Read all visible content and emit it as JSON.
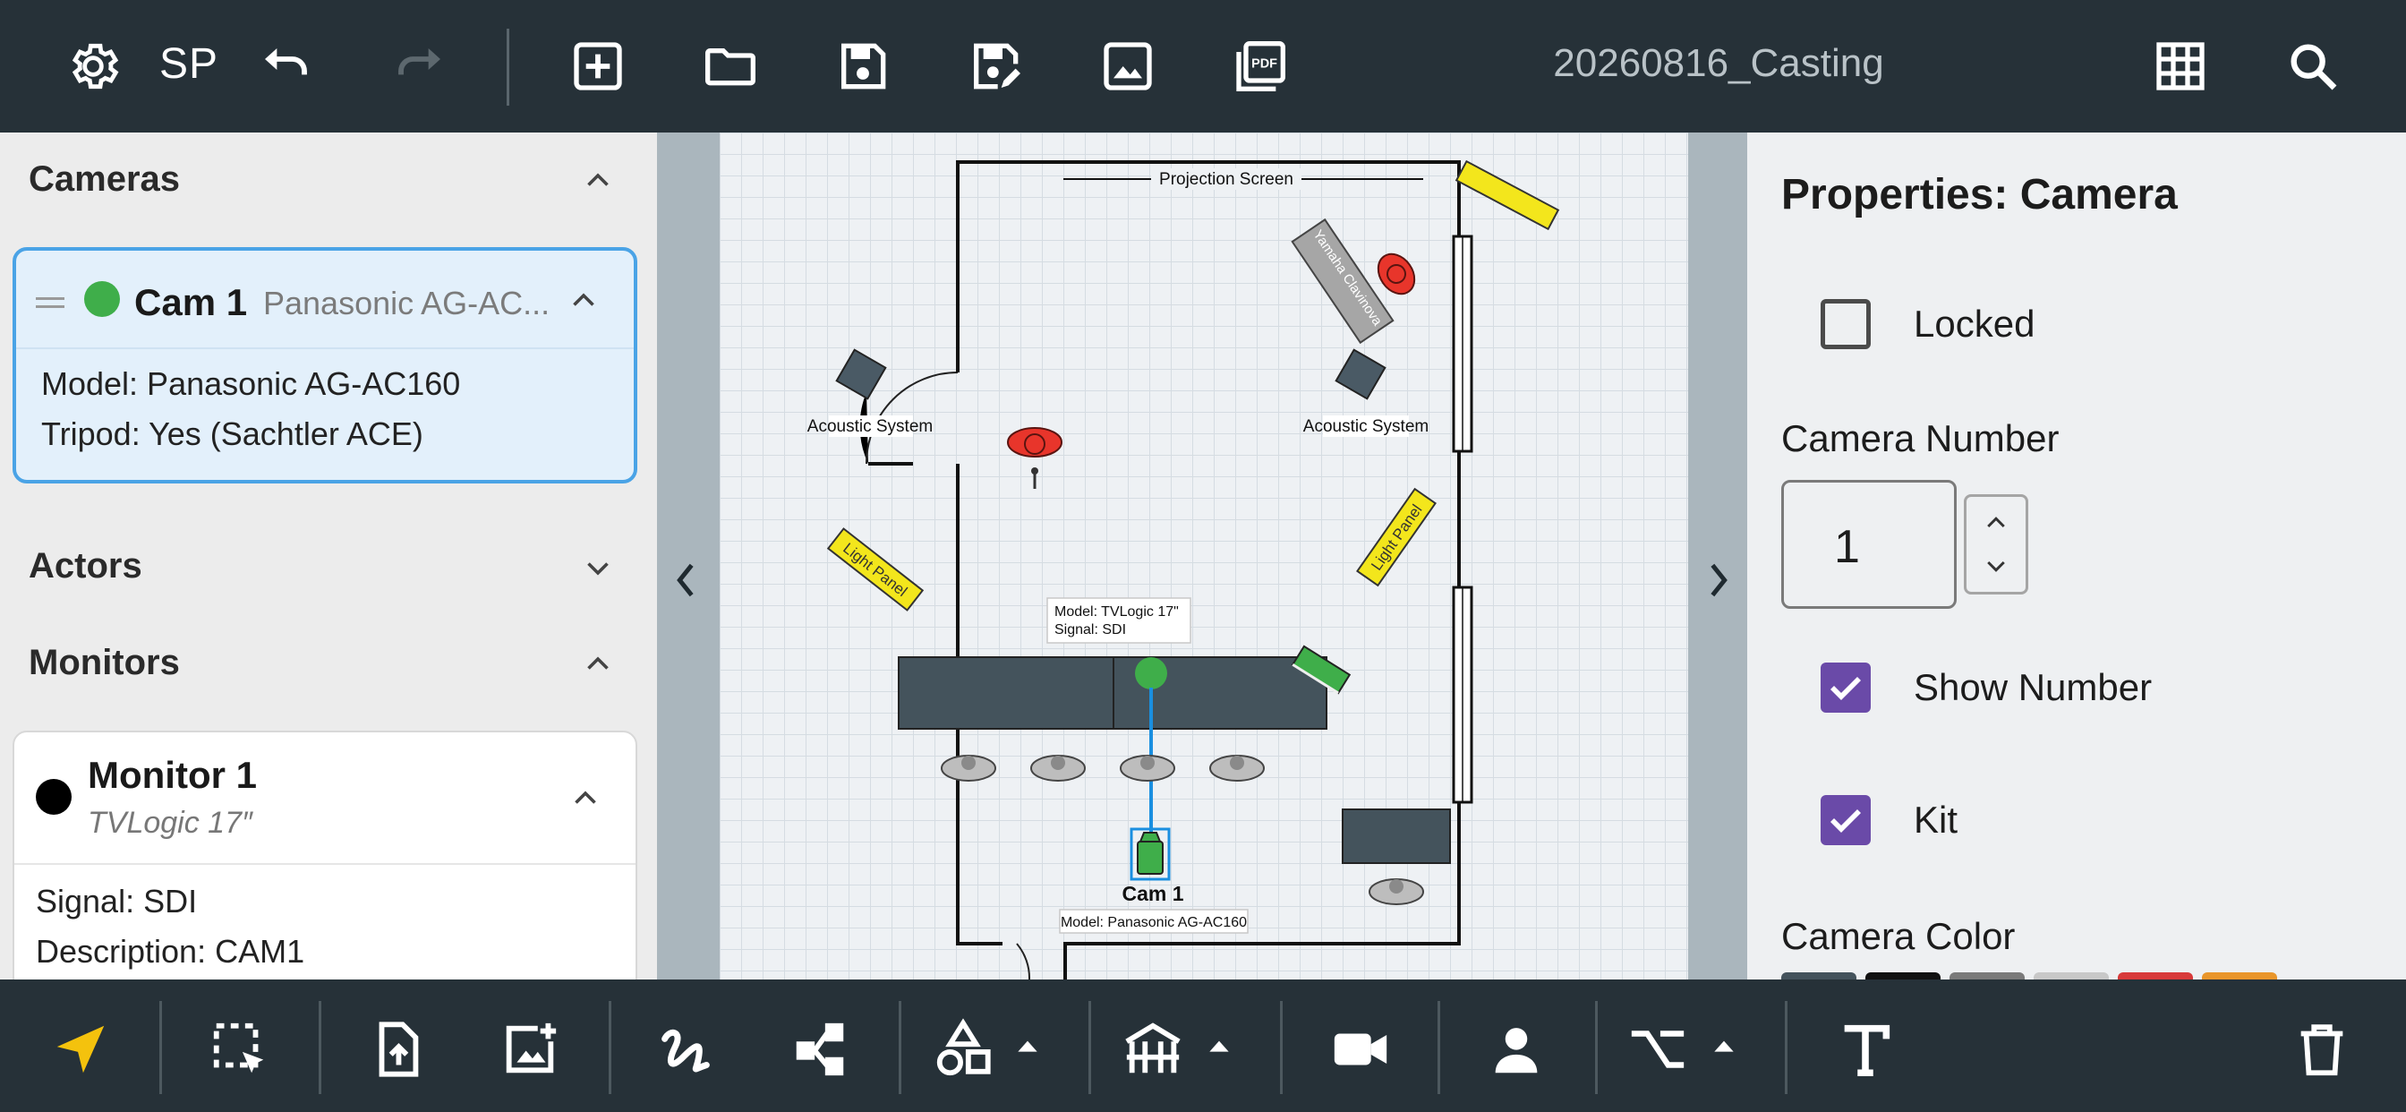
{
  "toolbar": {
    "user_initials": "SP",
    "document_title": "20260816_Casting",
    "icons": [
      "gear-icon",
      "undo-icon",
      "redo-icon",
      "add-icon",
      "folder-icon",
      "save-icon",
      "save-as-icon",
      "image-export-icon",
      "pdf-export-icon",
      "grid-icon",
      "search-icon"
    ],
    "pdf_badge": "PDF"
  },
  "sidebar": {
    "cameras": {
      "title": "Cameras",
      "items": [
        {
          "name": "Cam 1",
          "model_short": "Panasonic AG-AC...",
          "model_line": "Model: Panasonic AG-AC160",
          "tripod_line": "Tripod: Yes (Sachtler ACE)",
          "status_color": "#3fae4a"
        }
      ]
    },
    "actors": {
      "title": "Actors"
    },
    "monitors": {
      "title": "Monitors",
      "items": [
        {
          "name": "Monitor 1",
          "model": "TVLogic 17″",
          "signal_line": "Signal: SDI",
          "description_line": "Description: CAM1",
          "status_color": "#000000"
        }
      ]
    }
  },
  "floorplan": {
    "labels": {
      "projection_screen": "Projection Screen",
      "acoustic_left": "Acoustic System",
      "acoustic_right": "Acoustic System",
      "light_panel_left": "Light Panel",
      "light_panel_right": "Light Panel",
      "piano": "Yamaha Clavinova",
      "monitor_tooltip_model": "Model: TVLogic 17\"",
      "monitor_tooltip_signal": "Signal: SDI",
      "camera_label": "Cam 1",
      "camera_tooltip": "Model: Panasonic AG-AC160"
    },
    "colors": {
      "wall": "#111111",
      "desk": "#44535c",
      "camera": "#3fae4a",
      "selection": "#1a8fe0",
      "light_panel": "#f3e61c",
      "spotlight": "#e8352b"
    }
  },
  "properties": {
    "title": "Properties: Camera",
    "locked": {
      "label": "Locked",
      "checked": false
    },
    "camera_number": {
      "label": "Camera Number",
      "value": "1"
    },
    "show_number": {
      "label": "Show Number",
      "checked": true
    },
    "kit": {
      "label": "Kit",
      "checked": true
    },
    "camera_color": {
      "label": "Camera Color",
      "swatches": [
        "#44535c",
        "#111111",
        "#7a7a7a",
        "#c8c8c8",
        "#d83a3a",
        "#e9962a"
      ]
    },
    "accent": "#6a4aa8"
  },
  "bottom_toolbar": {
    "tools": [
      "pointer-icon",
      "marquee-select-icon",
      "import-file-icon",
      "add-image-icon",
      "freehand-icon",
      "connector-icon",
      "shapes-icon",
      "structure-icon",
      "camera-icon",
      "person-icon",
      "path-icon",
      "text-icon",
      "trash-icon"
    ],
    "active_tool": "pointer-icon",
    "active_color": "#f4c20d"
  }
}
